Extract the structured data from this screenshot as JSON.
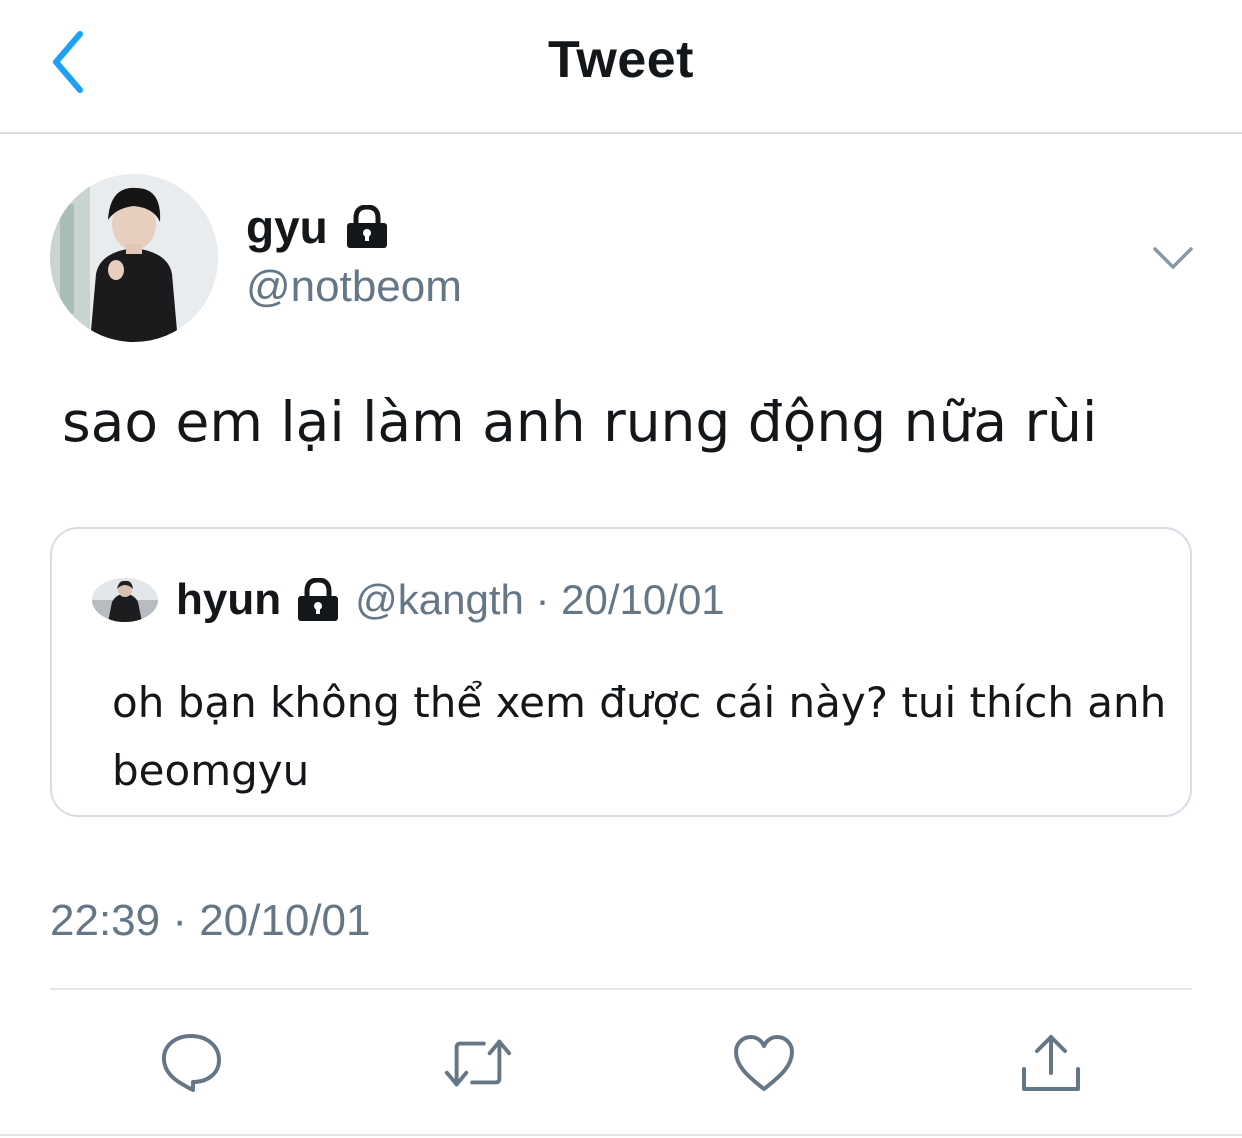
{
  "header": {
    "back_icon": "chevron-left-icon",
    "title": "Tweet"
  },
  "tweet": {
    "author": {
      "display_name": "gyu",
      "handle": "@notbeom",
      "protected_icon": "lock-icon"
    },
    "menu_icon": "chevron-down-icon",
    "text": "sao em lại làm anh rung động nữa rùi",
    "quoted": {
      "display_name": "hyun",
      "protected_icon": "lock-icon",
      "handle_date": "@kangth · 20/10/01",
      "text": "oh bạn không thể xem được cái này? tui thích anh beomgyu"
    },
    "timestamp": "22:39 · 20/10/01"
  },
  "actions": [
    {
      "name": "reply",
      "icon": "reply-icon"
    },
    {
      "name": "retweet",
      "icon": "retweet-icon"
    },
    {
      "name": "like",
      "icon": "heart-icon"
    },
    {
      "name": "share",
      "icon": "share-icon"
    }
  ],
  "colors": {
    "accent": "#1da1f2",
    "text": "#14171a",
    "secondary": "#657786",
    "border": "#d6dde3"
  }
}
